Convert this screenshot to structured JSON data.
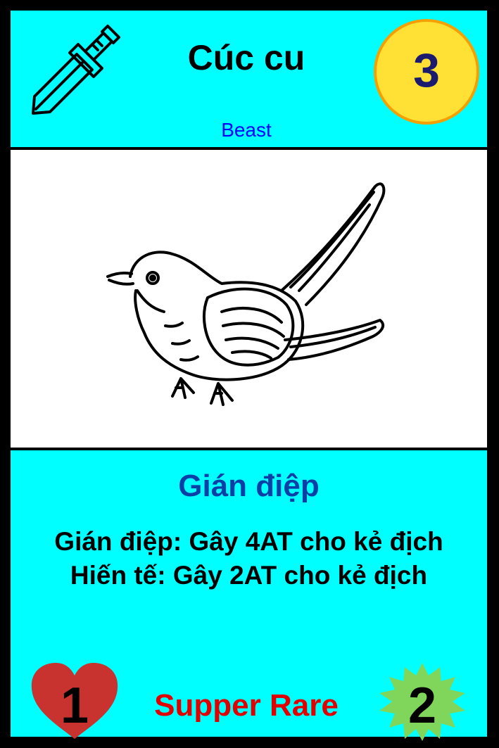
{
  "card": {
    "name": "Cúc cu",
    "type": "Beast",
    "cost": "3",
    "ability_title": "Gián điệp",
    "ability_lines": [
      "Gián điệp: Gây 4AT cho kẻ địch",
      "Hiến tế: Gây 2AT cho kẻ địch"
    ],
    "health": "1",
    "rarity": "Supper Rare",
    "attack": "2"
  },
  "colors": {
    "panel": "#00FFFF",
    "frame": "#000000",
    "type_text": "#0000FF",
    "ability_title": "#0B3FA8",
    "rarity": "#E00000",
    "cost_coin": "#FFE135",
    "cost_coin_border": "#F5A000",
    "heart": "#C8322F",
    "burst": "#7FD65B"
  },
  "icons": {
    "class": "sword-icon",
    "health": "heart-icon",
    "attack": "starburst-icon",
    "art": "cuckoo-bird-illustration"
  }
}
